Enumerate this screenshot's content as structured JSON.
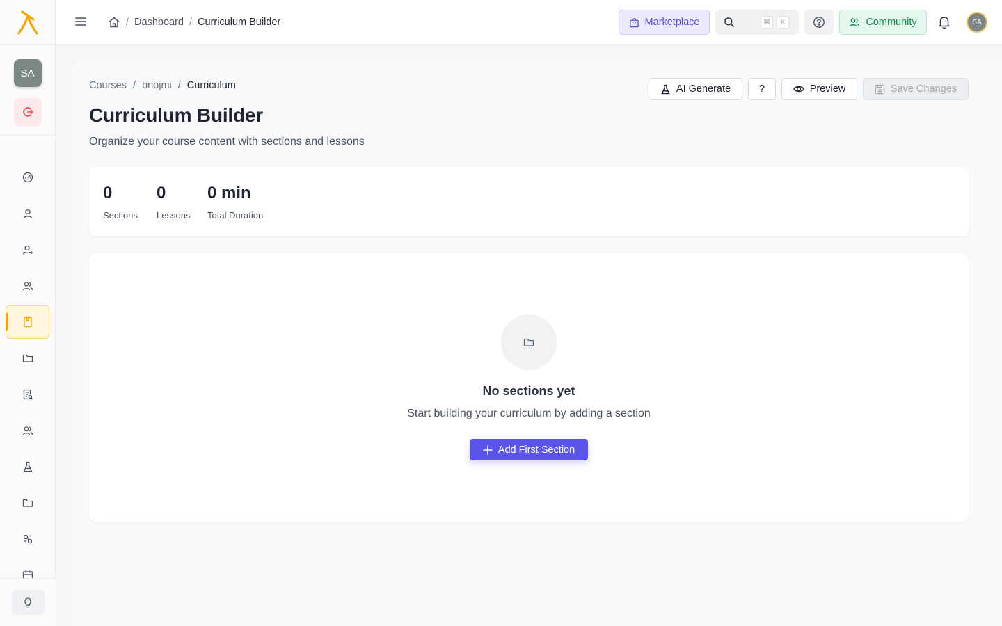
{
  "colors": {
    "accent": "#5a54ea",
    "brand": "#f5a500",
    "community": "#138a4c"
  },
  "sidebar": {
    "avatar_initials": "SA",
    "nav_icons": [
      "gauge-icon",
      "user-icon",
      "user-plus-icon",
      "users-icon",
      "book-icon",
      "folder-icon",
      "report-icon",
      "users-icon",
      "flask-icon",
      "folder-icon",
      "links-icon",
      "calendar-icon"
    ],
    "active_index": 4
  },
  "topbar": {
    "breadcrumb": [
      "Dashboard",
      "Curriculum Builder"
    ],
    "marketplace_label": "Marketplace",
    "kbd_cmd": "⌘",
    "kbd_k": "K",
    "community_label": "Community",
    "avatar_initials": "SA"
  },
  "page": {
    "breadcrumb": [
      "Courses",
      "bnojmi",
      "Curriculum"
    ],
    "title": "Curriculum Builder",
    "subtitle": "Organize your course content with sections and lessons",
    "actions": {
      "ai_generate": "AI Generate",
      "help": "?",
      "preview": "Preview",
      "save": "Save Changes"
    }
  },
  "stats": [
    {
      "value": "0",
      "label": "Sections"
    },
    {
      "value": "0",
      "label": "Lessons"
    },
    {
      "value": "0 min",
      "label": "Total Duration"
    }
  ],
  "empty_state": {
    "title": "No sections yet",
    "subtitle": "Start building your curriculum by adding a section",
    "button_label": "Add First Section"
  }
}
